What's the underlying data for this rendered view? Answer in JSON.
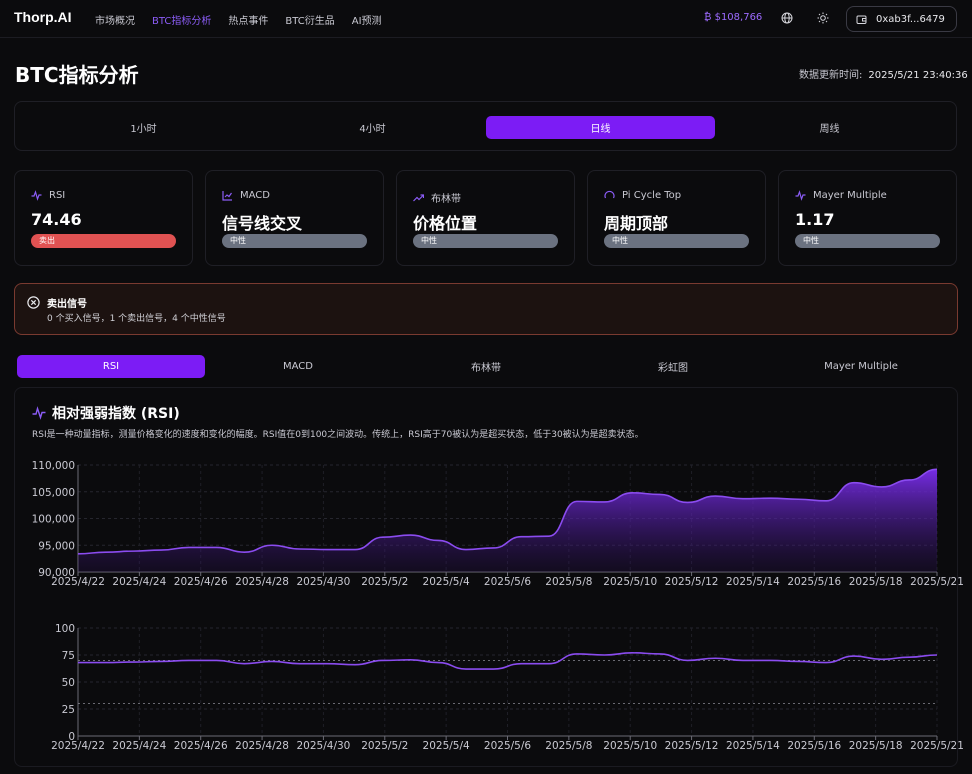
{
  "nav": {
    "logo": "Thorp.AI",
    "links": [
      "市场概况",
      "BTC指标分析",
      "热点事件",
      "BTC衍生品",
      "AI预测"
    ],
    "active_index": 1,
    "price": "₿ $108,766",
    "wallet": "0xab3f...6479",
    "icons": [
      "globe-icon",
      "sun-icon",
      "wallet-icon"
    ]
  },
  "page": {
    "title": "BTC指标分析",
    "updated_label": "数据更新时间:",
    "updated_value": "2025/5/21 23:40:36"
  },
  "timeframes": {
    "options": [
      "1小时",
      "4小时",
      "日线",
      "周线"
    ],
    "active_index": 2
  },
  "indicators": [
    {
      "name": "RSI",
      "value": "74.46",
      "signal": "卖出",
      "icon": "activity-icon"
    },
    {
      "name": "MACD",
      "value": "信号线交叉",
      "signal": "中性",
      "icon": "line-chart-icon"
    },
    {
      "name": "布林带",
      "value": "价格位置",
      "signal": "中性",
      "icon": "trend-icon"
    },
    {
      "name": "Pi Cycle Top",
      "value": "周期顶部",
      "signal": "中性",
      "icon": "gauge-icon"
    },
    {
      "name": "Mayer Multiple",
      "value": "1.17",
      "signal": "中性",
      "icon": "activity-icon"
    }
  ],
  "alert": {
    "title": "卖出信号",
    "detail": "0 个买入信号，1 个卖出信号，4 个中性信号"
  },
  "chart_tabs": {
    "options": [
      "RSI",
      "MACD",
      "布林带",
      "彩虹图",
      "Mayer Multiple"
    ],
    "active_index": 0
  },
  "panel": {
    "title": "相对强弱指数 (RSI)",
    "description": "RSI是一种动量指标，测量价格变化的速度和变化的幅度。RSI值在0到100之间波动。传统上，RSI高于70被认为是超买状态，低于30被认为是超卖状态。"
  },
  "colors": {
    "accent": "#7c1cf5",
    "sell": "#e05252",
    "neutral": "#6b7280",
    "line": "#8b4cf0"
  },
  "chart_data": [
    {
      "type": "area",
      "x_tick_labels": [
        "2025/4/22",
        "2025/4/24",
        "2025/4/26",
        "2025/4/28",
        "2025/4/30",
        "2025/5/2",
        "2025/5/4",
        "2025/5/6",
        "2025/5/8",
        "2025/5/10",
        "2025/5/12",
        "2025/5/14",
        "2025/5/16",
        "2025/5/18",
        "2025/5/21"
      ],
      "y_tick_labels": [
        "90,000",
        "95,000",
        "100,000",
        "105,000",
        "110,000"
      ],
      "ylim": [
        90000,
        110000
      ],
      "values": [
        93400,
        93700,
        93900,
        94100,
        94600,
        94600,
        93700,
        95000,
        94300,
        94200,
        94200,
        96500,
        96900,
        95900,
        94200,
        94500,
        96600,
        96700,
        103200,
        103100,
        104800,
        104500,
        103000,
        104200,
        103700,
        103800,
        103600,
        103300,
        106700,
        105900,
        107200,
        109200
      ]
    },
    {
      "type": "line",
      "x_tick_labels": [
        "2025/4/22",
        "2025/4/24",
        "2025/4/26",
        "2025/4/28",
        "2025/4/30",
        "2025/5/2",
        "2025/5/4",
        "2025/5/6",
        "2025/5/8",
        "2025/5/10",
        "2025/5/12",
        "2025/5/14",
        "2025/5/16",
        "2025/5/18",
        "2025/5/21"
      ],
      "y_tick_labels": [
        "0",
        "25",
        "50",
        "75",
        "100"
      ],
      "ylim": [
        0,
        100
      ],
      "reference_lines": [
        70,
        30
      ],
      "values": [
        68,
        68,
        68.5,
        69,
        70,
        70,
        67,
        69,
        67,
        67,
        66,
        70,
        70.5,
        68,
        62,
        62,
        67,
        67,
        76,
        75,
        77,
        76,
        70,
        72,
        70,
        70,
        69,
        68,
        74,
        71,
        73,
        75
      ]
    }
  ]
}
